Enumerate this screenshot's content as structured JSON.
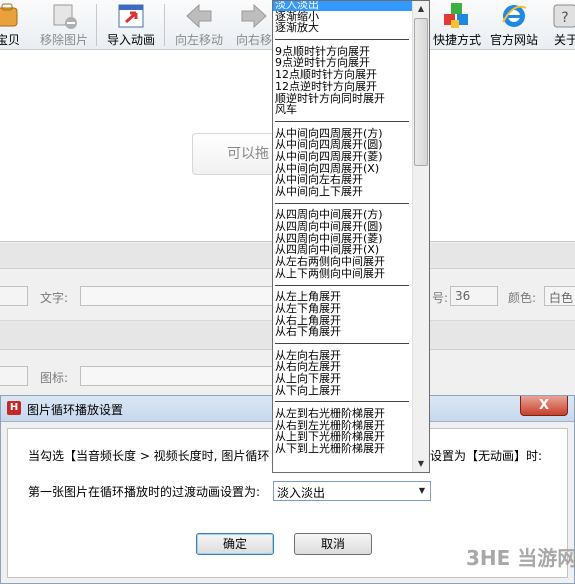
{
  "toolbar": {
    "items": [
      {
        "label": "宝贝",
        "icon": "bag-icon",
        "disabled": false
      },
      {
        "label": "移除图片",
        "icon": "remove-image-icon",
        "disabled": true
      },
      {
        "label": "导入动画",
        "icon": "import-animation-icon",
        "disabled": false
      },
      {
        "label": "向左移动",
        "icon": "arrow-left-icon",
        "disabled": true
      },
      {
        "label": "向右移",
        "icon": "arrow-right-icon",
        "disabled": true
      },
      {
        "label": "快捷方式",
        "icon": "shortcut-cubes-icon",
        "disabled": false
      },
      {
        "label": "官方网站",
        "icon": "ie-browser-icon",
        "disabled": false
      },
      {
        "label": "关于",
        "icon": "about-icon",
        "disabled": false
      }
    ]
  },
  "canvas": {
    "drag_hint": "可以拖"
  },
  "props": {
    "text_label": "文字:",
    "size_value": "36",
    "color_label": "颜色:",
    "color_value": "白色",
    "icon_label": "图标:",
    "size_label_partial": "号:"
  },
  "dialog": {
    "title": "图片循环播放设置",
    "close_symbol": "X",
    "info_text": "当勾选【当音频长度 > 视频长度时, 图片循环",
    "info_text_end": "设置为【无动画】时:",
    "first_image_label": "第一张图片在循环播放时的过渡动画设置为:",
    "selected_value": "淡入淡出",
    "ok_label": "确定",
    "cancel_label": "取消"
  },
  "dropdown": {
    "items": [
      "淡入淡出",
      "逐渐缩小",
      "逐渐放大",
      "---",
      "9点顺时针方向展开",
      "9点逆时针方向展开",
      "12点顺时针方向展开",
      "12点逆时针方向展开",
      "顺逆时针方向同时展开",
      "风车",
      "---",
      "从中间向四周展开(方)",
      "从中间向四周展开(圆)",
      "从中间向四周展开(菱)",
      "从中间向四周展开(X)",
      "从中间向左右展开",
      "从中间向上下展开",
      "---",
      "从四周向中间展开(方)",
      "从四周向中间展开(圆)",
      "从四周向中间展开(菱)",
      "从四周向中间展开(X)",
      "从左右两侧向中间展开",
      "从上下两侧向中间展开",
      "---",
      "从左上角展开",
      "从左下角展开",
      "从右上角展开",
      "从右下角展开",
      "---",
      "从左向右展开",
      "从右向左展开",
      "从上向下展开",
      "从下向上展开",
      "---",
      "从左到右光栅阶梯展开",
      "从右到左光栅阶梯展开",
      "从上到下光栅阶梯展开",
      "从下到上光栅阶梯展开"
    ],
    "selected_index": 0
  },
  "watermark": "3HE 当游网",
  "colors": {
    "selection": "#3399ff",
    "dialog_title": "#c7d8ec",
    "close_button": "#c7402b"
  }
}
